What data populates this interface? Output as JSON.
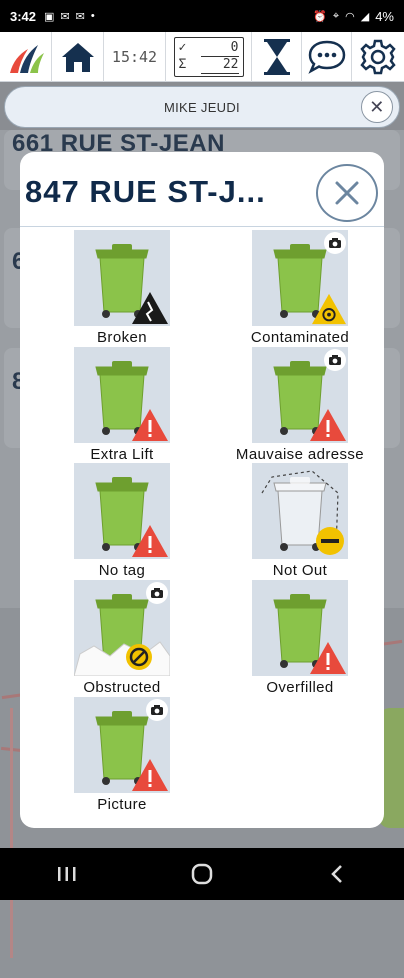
{
  "status_bar": {
    "time": "3:42",
    "battery": "4%"
  },
  "toolbar": {
    "clock": "15:42",
    "counter": {
      "done_symbol": "✓",
      "done_value": "0",
      "total_symbol": "Σ",
      "total_value": "22"
    }
  },
  "driver": {
    "name": "MIKE JEUDI"
  },
  "background_list": {
    "items": [
      {
        "address": "661 RUE ST-JEAN"
      },
      {
        "address": "6"
      },
      {
        "address": "8"
      }
    ]
  },
  "modal": {
    "title": "847 RUE ST-J...",
    "reasons": [
      {
        "label": "Broken",
        "icon": "broken-bin-icon",
        "camera": false,
        "badge": "broken",
        "badge_color": "#1a1a1a"
      },
      {
        "label": "Contaminated",
        "icon": "contaminated-bin-icon",
        "camera": true,
        "badge": "biohazard",
        "badge_color": "#f2c200"
      },
      {
        "label": "Extra Lift",
        "icon": "extra-lift-bin-icon",
        "camera": false,
        "badge": "warning",
        "badge_color": "#e84a3c"
      },
      {
        "label": "Mauvaise adresse",
        "icon": "wrong-address-bin-icon",
        "camera": true,
        "badge": "warning",
        "badge_color": "#e84a3c"
      },
      {
        "label": "No tag",
        "icon": "no-tag-bin-icon",
        "camera": false,
        "badge": "warning",
        "badge_color": "#e84a3c"
      },
      {
        "label": "Not Out",
        "icon": "not-out-bin-icon",
        "camera": false,
        "badge": "minus",
        "badge_color": "#f2c200"
      },
      {
        "label": "Obstructed",
        "icon": "obstructed-bin-icon",
        "camera": true,
        "badge": "blocked",
        "badge_color": "#f2c200"
      },
      {
        "label": "Overfilled",
        "icon": "overfilled-bin-icon",
        "camera": false,
        "badge": "warning",
        "badge_color": "#e84a3c"
      },
      {
        "label": "Picture",
        "icon": "picture-bin-icon",
        "camera": true,
        "badge": "warning",
        "badge_color": "#e84a3c"
      }
    ]
  },
  "colors": {
    "bin_green": "#8bc34a",
    "bin_green_dark": "#6e9f2f",
    "tile_bg": "#d6dee7",
    "title_navy": "#102a4a",
    "warning_red": "#e84a3c",
    "warning_yellow": "#f2c200"
  }
}
